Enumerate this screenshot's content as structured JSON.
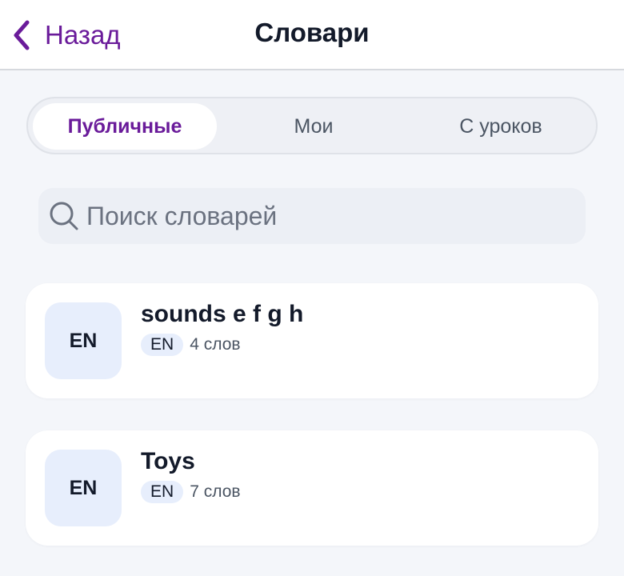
{
  "header": {
    "back_label": "Назад",
    "title": "Словари"
  },
  "tabs": [
    {
      "label": "Публичные",
      "active": true
    },
    {
      "label": "Мои",
      "active": false
    },
    {
      "label": "С уроков",
      "active": false
    }
  ],
  "search": {
    "placeholder": "Поиск словарей",
    "value": ""
  },
  "dictionaries": [
    {
      "avatar": "EN",
      "title": "sounds e f g h",
      "language": "EN",
      "count": "4 слов"
    },
    {
      "avatar": "EN",
      "title": "Toys",
      "language": "EN",
      "count": "7 слов"
    }
  ],
  "colors": {
    "accent": "#6a1b9a",
    "background": "#f4f6fa",
    "card": "#ffffff",
    "badge": "#e7eefc"
  },
  "icons": {
    "back": "chevron-left-icon",
    "search": "search-icon"
  }
}
